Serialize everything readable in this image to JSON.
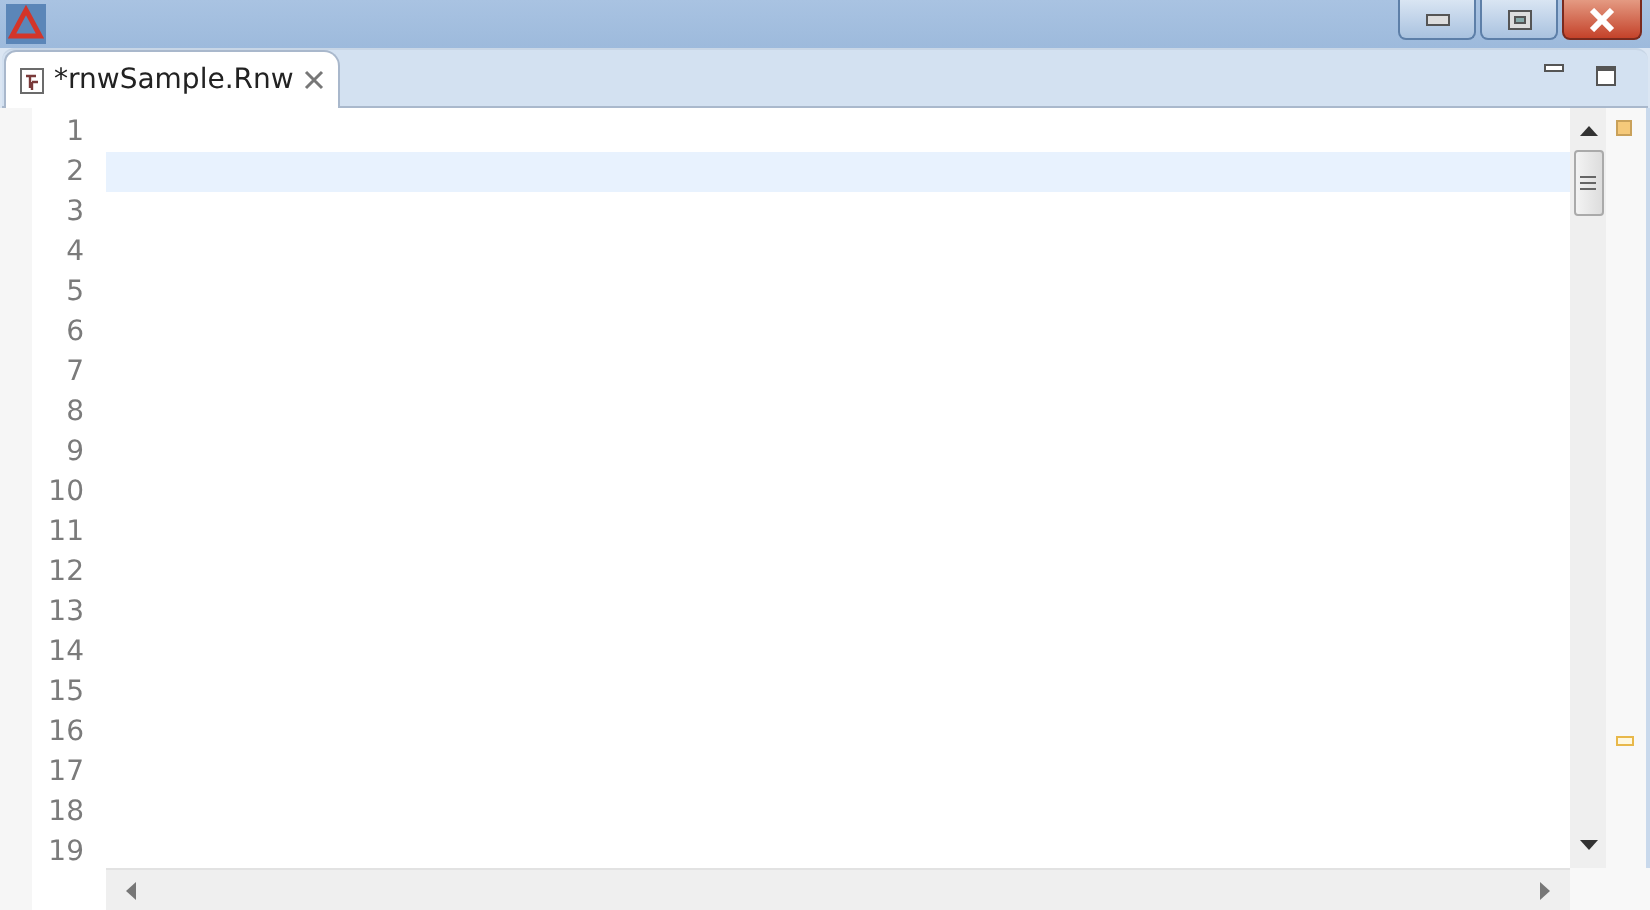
{
  "tabs": [
    {
      "label": "*rnwSample.Rnw",
      "selected": true
    }
  ],
  "editor": {
    "lines": [
      {
        "number": "1",
        "selected": false
      },
      {
        "number": "2",
        "selected": true
      },
      {
        "number": "3",
        "selected": false
      },
      {
        "number": "4",
        "selected": false
      },
      {
        "number": "5",
        "selected": false
      },
      {
        "number": "6",
        "selected": false
      },
      {
        "number": "7",
        "selected": false
      },
      {
        "number": "8",
        "selected": false
      },
      {
        "number": "9",
        "selected": false
      },
      {
        "number": "10",
        "selected": false
      },
      {
        "number": "11",
        "selected": false
      },
      {
        "number": "12",
        "selected": false
      },
      {
        "number": "13",
        "selected": false
      },
      {
        "number": "14",
        "selected": false
      },
      {
        "number": "15",
        "selected": false
      },
      {
        "number": "16",
        "selected": false
      },
      {
        "number": "17",
        "selected": false
      },
      {
        "number": "18",
        "selected": false
      },
      {
        "number": "19",
        "selected": false
      }
    ]
  }
}
